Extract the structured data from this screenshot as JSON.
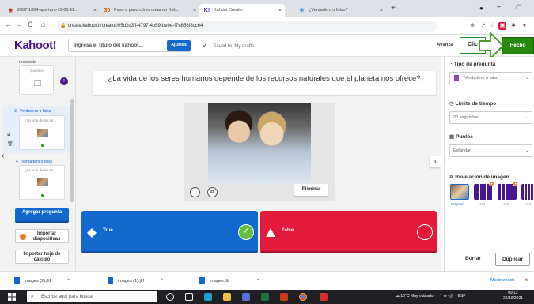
{
  "browser": {
    "tabs": [
      {
        "label": "2007-1094-apertura-10-01-11..",
        "active": false
      },
      {
        "label": "Paso a paso cómo crear un Kah..",
        "active": false
      },
      {
        "label": "Kahoot Creator",
        "active": true
      },
      {
        "label": "¿Verdadero o falso?",
        "active": false
      }
    ],
    "url": "create.kahoot.it/creator/05d2d3ff-4797-4b59-be0e-f7e856f8cc64"
  },
  "header": {
    "logo": "Kahoot!",
    "title_placeholder": "Ingresa el título del kahoot...",
    "settings_label": "Ajustes",
    "saved_status": "Saved to: My drafts",
    "advanced_label": "Avanza",
    "click_label": "Clic",
    "done_label": "Hecho"
  },
  "sidebar": {
    "top_slide_title": "respuesta",
    "top_slide_type": "Question",
    "slides": [
      {
        "number": "3",
        "type": "Verdadero o falso",
        "preview": "¿La vida de los se..."
      },
      {
        "number": "4",
        "type": "Verdadero o falso",
        "preview": "¿La vida de los se..."
      }
    ],
    "add_question": "Agregar pregunta",
    "import_slides": "Importar diapositivas",
    "import_sheet": "Importar hoja de cálculo"
  },
  "main": {
    "question": "¿La vida de los seres humanos depende de los recursos naturales que el planeta nos ofrece?",
    "delete_image": "Eliminar",
    "answers": [
      {
        "label": "True",
        "shape": "diamond",
        "correct": true
      },
      {
        "label": "False",
        "shape": "triangle",
        "correct": false
      }
    ]
  },
  "settings": {
    "question_type_title": "Tipo de pregunta",
    "question_type_value": "Verdadero o falso",
    "time_limit_title": "Límite de tiempo",
    "time_limit_value": "20 segundos",
    "points_title": "Puntos",
    "points_value": "Estándar",
    "reveal_title": "Revelación de imagen",
    "reveal_options": [
      "Original",
      "3x3",
      "3x5",
      "3x6"
    ],
    "delete_label": "Borrar",
    "duplicate_label": "Duplicar"
  },
  "downloads": {
    "items": [
      "images (2).jfif",
      "images (1).jfif",
      "images.jfif"
    ],
    "show_all": "Mostrar todo"
  },
  "taskbar": {
    "search_placeholder": "Escribe aquí para buscar",
    "weather": "10°C  Muy nublado",
    "lang": "ESP",
    "time": "09:12",
    "date": "25/10/2021"
  },
  "colors": {
    "kahoot_purple": "#46178f",
    "blue": "#1368ce",
    "red": "#e21b3c",
    "green": "#26890c"
  }
}
